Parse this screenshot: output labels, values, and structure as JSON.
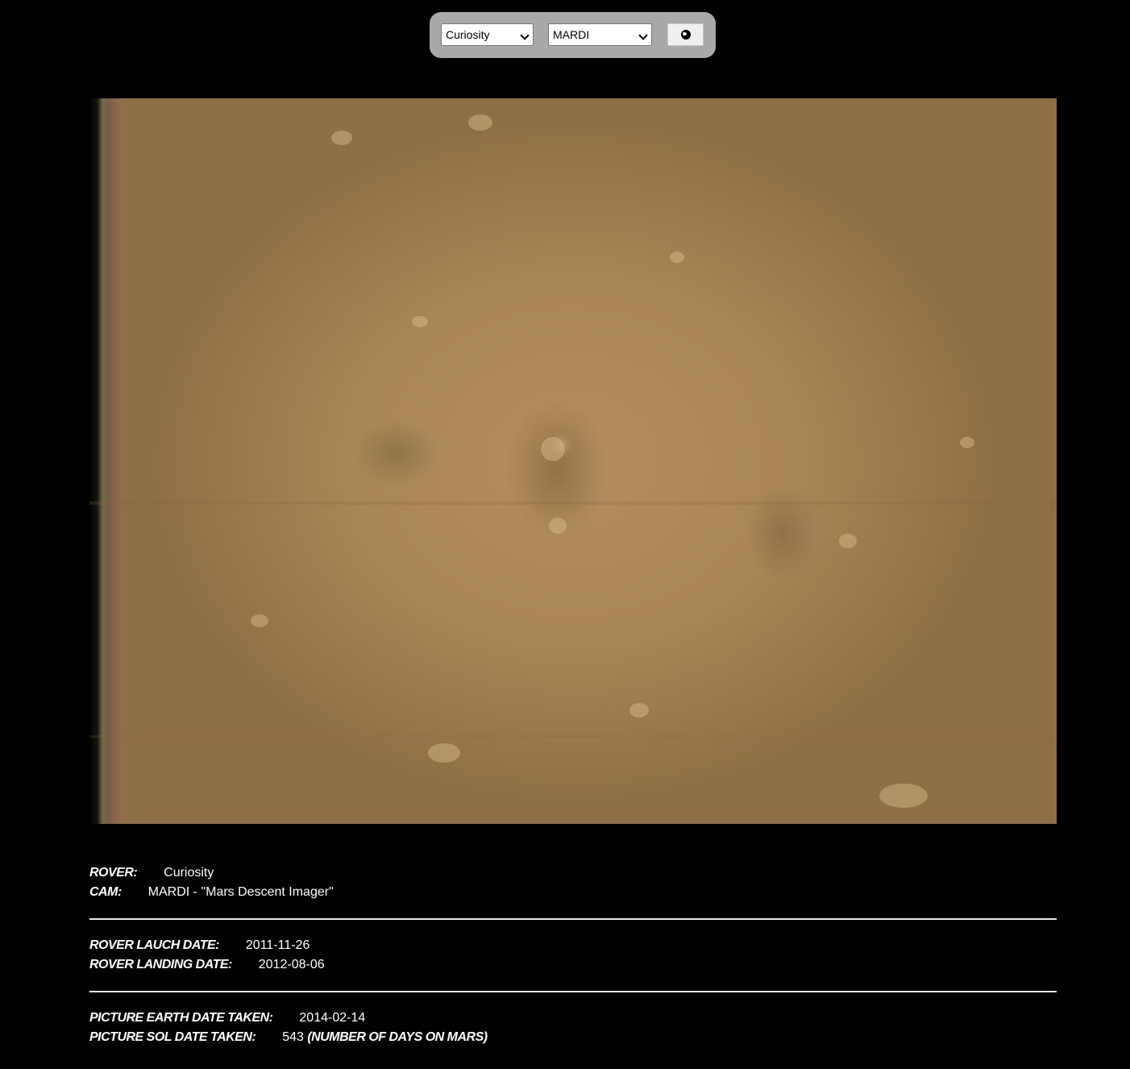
{
  "controls": {
    "rover_select_value": "Curiosity",
    "camera_select_value": "MARDI",
    "go_icon": "globe-icon"
  },
  "photo": {
    "alt": "Mars surface photo"
  },
  "details": {
    "rover_label": "ROVER:",
    "rover_value": "Curiosity",
    "cam_label": "CAM:",
    "cam_value": "MARDI - \"Mars Descent Imager\"",
    "launch_label": "ROVER LAUCH DATE:",
    "launch_value": "2011-11-26",
    "landing_label": "ROVER LANDING DATE:",
    "landing_value": "2012-08-06",
    "earth_date_label": "PICTURE EARTH DATE TAKEN:",
    "earth_date_value": "2014-02-14",
    "sol_label": "PICTURE SOL DATE TAKEN:",
    "sol_value": "543",
    "sol_note": "(NUMBER OF DAYS ON MARS)"
  },
  "colors": {
    "background": "#000000",
    "controls_bar": "#a9a9a9",
    "text": "#ffffff"
  }
}
